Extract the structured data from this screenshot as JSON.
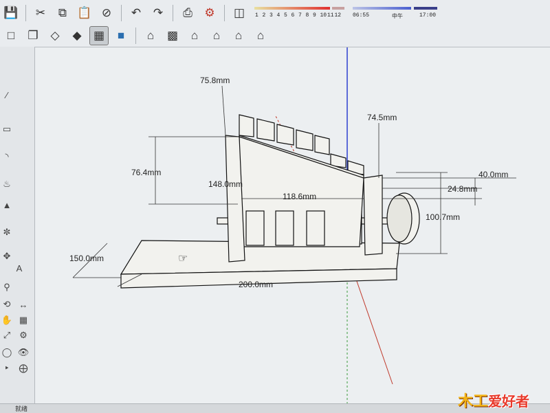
{
  "toolbar_top": {
    "icons": [
      "save-icon",
      "cut-icon",
      "copy-icon",
      "paste-icon",
      "erase-icon",
      "undo-icon",
      "redo-icon",
      "print-icon",
      "model-info-icon"
    ]
  },
  "shadow_panel": {
    "month_ticks": [
      "1",
      "2",
      "3",
      "4",
      "5",
      "6",
      "7",
      "8",
      "9",
      "10",
      "11",
      "12"
    ],
    "time_start": "06:55",
    "time_mid": "中午",
    "time_end": "17:00"
  },
  "toolbar_views": {
    "icons": [
      "xray-icon",
      "wireframe-icon",
      "hidden-line-icon",
      "shaded-icon",
      "shaded-texture-icon",
      "iso-view-icon",
      "top-view-icon",
      "front-view-icon",
      "right-view-icon",
      "back-view-icon",
      "left-view-icon"
    ]
  },
  "dimensions": {
    "d_75_8": "75.8mm",
    "d_74_5": "74.5mm",
    "d_76_4": "76.4mm",
    "d_148": "148.0mm",
    "d_118_6": "118.6mm",
    "d_40": "40.0mm",
    "d_24_8": "24.8mm",
    "d_100": "100.7mm",
    "d_150": "150.0mm",
    "d_200": "200.0mm"
  },
  "status": {
    "text": "就绪"
  },
  "logo": {
    "mark": "木工",
    "text": "爱好者"
  },
  "colors": {
    "model_face": "#f2f2ee",
    "model_edge": "#111111",
    "axis_blue": "#2b3fd0",
    "axis_red": "#c0392b",
    "axis_green": "#3a9a3a"
  }
}
